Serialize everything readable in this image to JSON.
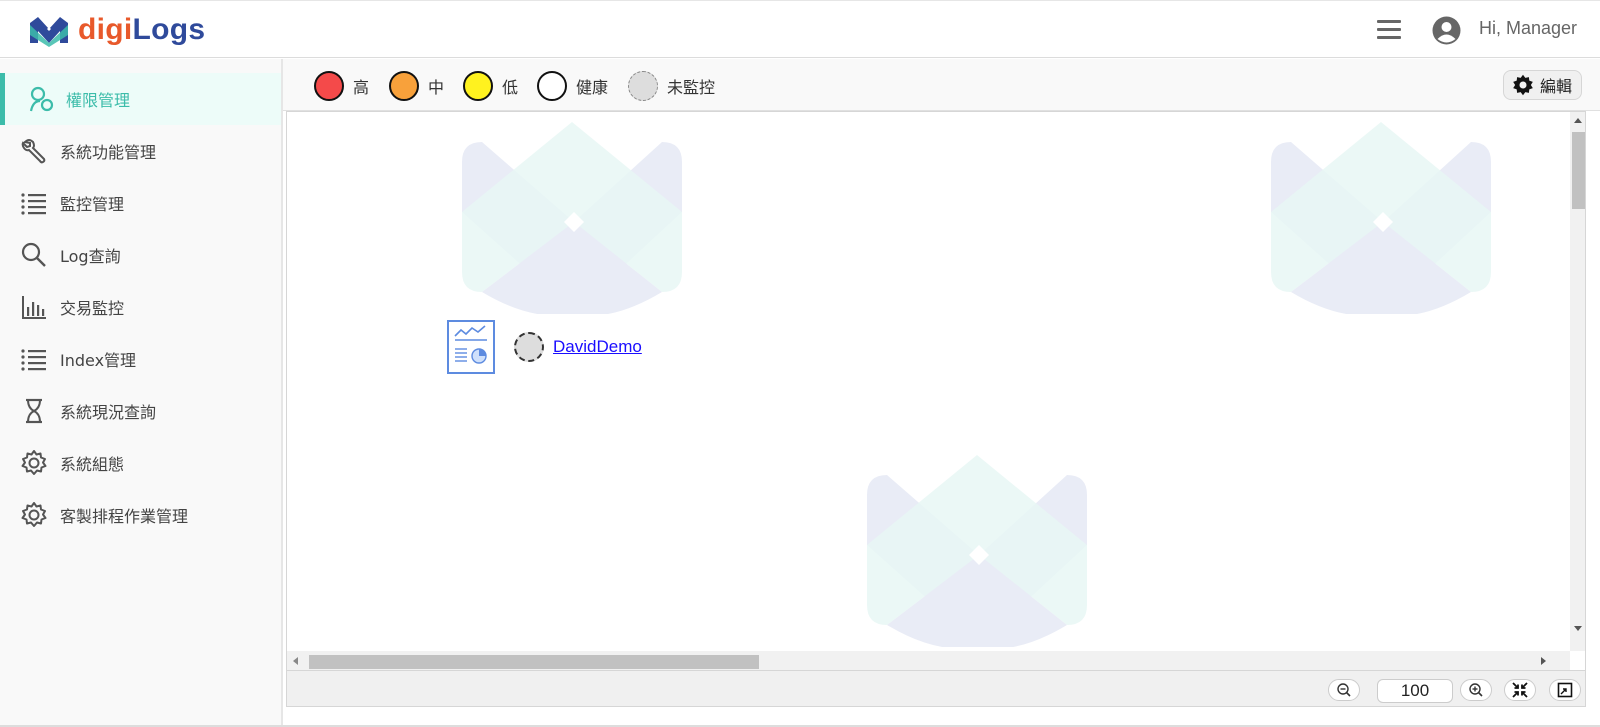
{
  "header": {
    "brand_part1": "digi",
    "brand_part2": "Logs",
    "greeting": "Hi, Manager",
    "menu_icon": "hamburger-icon",
    "user_icon": "user-avatar-icon"
  },
  "sidebar": {
    "items": [
      {
        "label": "權限管理",
        "icon": "user-permission-icon",
        "active": true
      },
      {
        "label": "系統功能管理",
        "icon": "wrench-icon"
      },
      {
        "label": "監控管理",
        "icon": "list-icon"
      },
      {
        "label": "Log查詢",
        "icon": "search-icon"
      },
      {
        "label": "交易監控",
        "icon": "bar-chart-icon"
      },
      {
        "label": "Index管理",
        "icon": "list-icon"
      },
      {
        "label": "系統現況查詢",
        "icon": "hourglass-icon"
      },
      {
        "label": "系統組態",
        "icon": "gear-icon"
      },
      {
        "label": "客製排程作業管理",
        "icon": "gear-icon"
      }
    ]
  },
  "legend": {
    "items": [
      {
        "label": "高",
        "color": "#f44a4a"
      },
      {
        "label": "中",
        "color": "#f8a13b"
      },
      {
        "label": "低",
        "color": "#fff21f"
      },
      {
        "label": "健康",
        "color": "#ffffff"
      },
      {
        "label": "未監控",
        "color": "#dddddd"
      }
    ],
    "edit_label": "編輯"
  },
  "canvas": {
    "node": {
      "label": "DavidDemo",
      "status": "未監控",
      "icon": "report-chart-icon"
    }
  },
  "zoom": {
    "value": "100"
  },
  "colors": {
    "accent": "#3cbcaa",
    "active_bg": "#edfcf9",
    "brand_orange": "#e8592b",
    "brand_blue": "#2f4a9b",
    "link": "#1a0dff"
  }
}
